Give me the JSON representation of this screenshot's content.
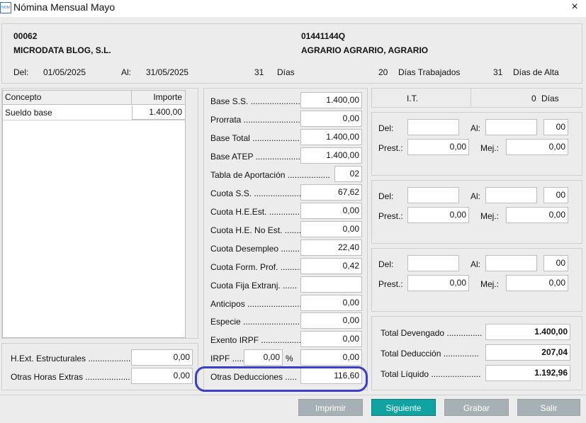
{
  "window": {
    "title": "Nómina Mensual Mayo",
    "icon_text": "NOM",
    "close": "×"
  },
  "header": {
    "company_code": "00062",
    "company_name": "MICRODATA BLOG, S.L.",
    "employee_code": "01441144Q",
    "employee_name": "AGRARIO AGRARIO, AGRARIO",
    "del_label": "Del:",
    "del_value": "01/05/2025",
    "al_label": "Al:",
    "al_value": "31/05/2025",
    "days": "31",
    "days_label": "Días",
    "worked_days": "20",
    "worked_label": "Días Trabajados",
    "alta_days": "31",
    "alta_label": "Días de Alta"
  },
  "concepts": {
    "col_concept": "Concepto",
    "col_amount": "Importe",
    "rows": [
      {
        "concept": "Sueldo base",
        "amount": "1.400,00"
      }
    ]
  },
  "extras": {
    "structural_label": "H.Ext. Estructurales ..................",
    "structural_value": "0,00",
    "other_label": "Otras Horas Extras ...................",
    "other_value": "0,00"
  },
  "bases": {
    "base_ss_label": "Base S.S. .........................",
    "base_ss": "1.400,00",
    "prorrata_label": "Prorrata ...........................",
    "prorrata": "0,00",
    "base_total_label": "Base Total .......................",
    "base_total": "1.400,00",
    "base_atep_label": "Base ATEP ........................",
    "base_atep": "1.400,00",
    "tabla_label": "Tabla de Aportación ..................",
    "tabla": "02",
    "cuota_ss_label": "Cuota S.S. .......................",
    "cuota_ss": "67,62",
    "cuota_he_est_label": "Cuota H.E.Est. ..............",
    "cuota_he_est": "0,00",
    "cuota_he_noest_label": "Cuota H.E. No Est. ........",
    "cuota_he_noest": "0,00",
    "cuota_desempleo_label": "Cuota Desempleo ........",
    "cuota_desempleo": "22,40",
    "cuota_form_label": "Cuota Form. Prof. ..........",
    "cuota_form": "0,42",
    "cuota_fija_label": "Cuota Fija Extranj. ......",
    "cuota_fija": "",
    "anticipos_label": "Anticipos .........................",
    "anticipos": "0,00",
    "especie_label": "Especie ............................",
    "especie": "0,00",
    "exento_label": "Exento IRPF ...................",
    "exento": "0,00",
    "irpf_label": "IRPF .......",
    "irpf_pct": "0,00",
    "irpf_pct_sign": "%",
    "irpf": "0,00",
    "otras_label": "Otras Deducciones .....",
    "otras": "116,60"
  },
  "it": {
    "label": "I.T.",
    "days": "0",
    "days_label": "Días"
  },
  "periods": [
    {
      "del_label": "Del:",
      "al_label": "Al:",
      "del": "",
      "al": "",
      "num": "00",
      "prest_label": "Prest.:",
      "prest": "0,00",
      "mej_label": "Mej.:",
      "mej": "0,00"
    },
    {
      "del_label": "Del:",
      "al_label": "Al:",
      "del": "",
      "al": "",
      "num": "00",
      "prest_label": "Prest.:",
      "prest": "0,00",
      "mej_label": "Mej.:",
      "mej": "0,00"
    },
    {
      "del_label": "Del:",
      "al_label": "Al:",
      "del": "",
      "al": "",
      "num": "00",
      "prest_label": "Prest.:",
      "prest": "0,00",
      "mej_label": "Mej.:",
      "mej": "0,00"
    }
  ],
  "totals": {
    "devengado_label": "Total Devengado ...............",
    "devengado": "1.400,00",
    "deduccion_label": "Total Deducción ...............",
    "deduccion": "207,04",
    "liquido_label": "Total Líquido .....................",
    "liquido": "1.192,96"
  },
  "buttons": {
    "print": "Imprimir",
    "next": "Siguiente",
    "save": "Grabar",
    "exit": "Salir"
  },
  "colors": {
    "primary": "#10a3a1",
    "disabled": "#a7b1b5",
    "highlight": "#3b3fc8"
  }
}
